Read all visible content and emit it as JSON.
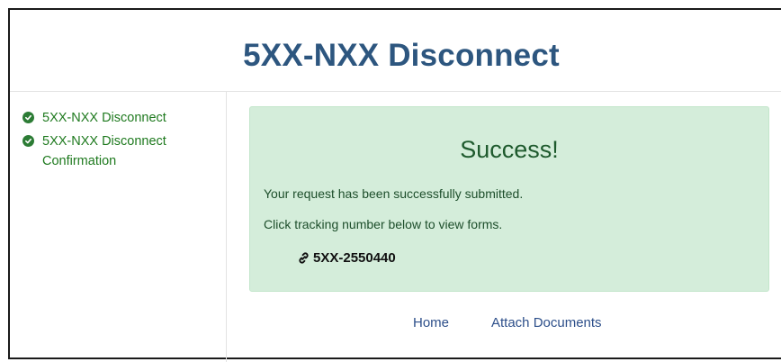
{
  "header": {
    "title": "5XX-NXX Disconnect"
  },
  "sidebar": {
    "items": [
      {
        "label": "5XX-NXX Disconnect",
        "icon": "check-circle-icon",
        "status": "complete"
      },
      {
        "label": "5XX-NXX Disconnect Confirmation",
        "icon": "check-circle-icon",
        "status": "complete"
      }
    ],
    "color": "#1f7a1f"
  },
  "alert": {
    "title": "Success!",
    "message": "Your request has been successfully submitted.",
    "instruction": "Click tracking number below to view forms.",
    "tracking_number": "5XX-2550440",
    "tracking_icon": "link-icon",
    "background": "#d4edda"
  },
  "footer_nav": {
    "home_label": "Home",
    "attach_label": "Attach Documents"
  },
  "colors": {
    "title": "#2d567f",
    "link": "#2d4f8a"
  }
}
